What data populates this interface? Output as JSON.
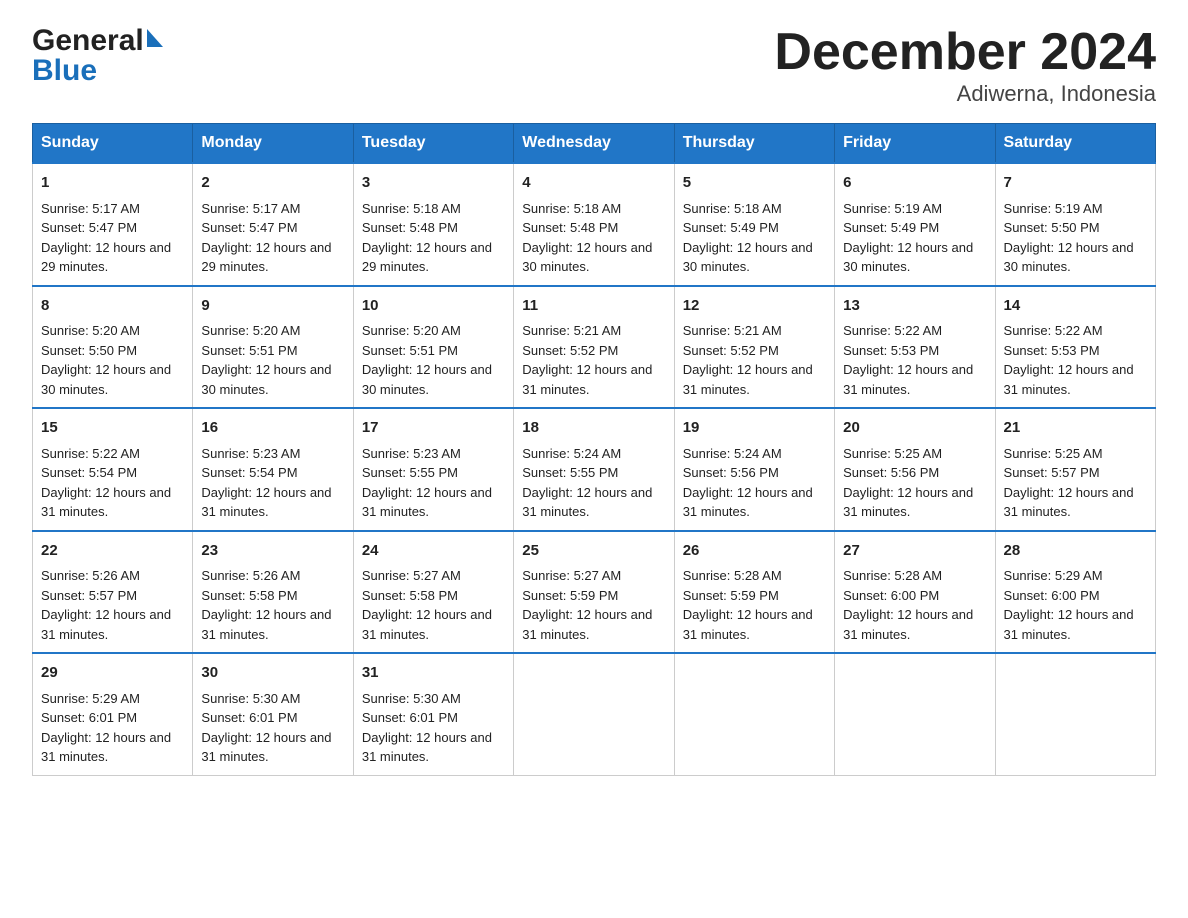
{
  "header": {
    "logo_general": "General",
    "logo_blue": "Blue",
    "title": "December 2024",
    "subtitle": "Adiwerna, Indonesia"
  },
  "weekdays": [
    "Sunday",
    "Monday",
    "Tuesday",
    "Wednesday",
    "Thursday",
    "Friday",
    "Saturday"
  ],
  "weeks": [
    [
      {
        "day": "1",
        "sunrise": "5:17 AM",
        "sunset": "5:47 PM",
        "daylight": "12 hours and 29 minutes."
      },
      {
        "day": "2",
        "sunrise": "5:17 AM",
        "sunset": "5:47 PM",
        "daylight": "12 hours and 29 minutes."
      },
      {
        "day": "3",
        "sunrise": "5:18 AM",
        "sunset": "5:48 PM",
        "daylight": "12 hours and 29 minutes."
      },
      {
        "day": "4",
        "sunrise": "5:18 AM",
        "sunset": "5:48 PM",
        "daylight": "12 hours and 30 minutes."
      },
      {
        "day": "5",
        "sunrise": "5:18 AM",
        "sunset": "5:49 PM",
        "daylight": "12 hours and 30 minutes."
      },
      {
        "day": "6",
        "sunrise": "5:19 AM",
        "sunset": "5:49 PM",
        "daylight": "12 hours and 30 minutes."
      },
      {
        "day": "7",
        "sunrise": "5:19 AM",
        "sunset": "5:50 PM",
        "daylight": "12 hours and 30 minutes."
      }
    ],
    [
      {
        "day": "8",
        "sunrise": "5:20 AM",
        "sunset": "5:50 PM",
        "daylight": "12 hours and 30 minutes."
      },
      {
        "day": "9",
        "sunrise": "5:20 AM",
        "sunset": "5:51 PM",
        "daylight": "12 hours and 30 minutes."
      },
      {
        "day": "10",
        "sunrise": "5:20 AM",
        "sunset": "5:51 PM",
        "daylight": "12 hours and 30 minutes."
      },
      {
        "day": "11",
        "sunrise": "5:21 AM",
        "sunset": "5:52 PM",
        "daylight": "12 hours and 31 minutes."
      },
      {
        "day": "12",
        "sunrise": "5:21 AM",
        "sunset": "5:52 PM",
        "daylight": "12 hours and 31 minutes."
      },
      {
        "day": "13",
        "sunrise": "5:22 AM",
        "sunset": "5:53 PM",
        "daylight": "12 hours and 31 minutes."
      },
      {
        "day": "14",
        "sunrise": "5:22 AM",
        "sunset": "5:53 PM",
        "daylight": "12 hours and 31 minutes."
      }
    ],
    [
      {
        "day": "15",
        "sunrise": "5:22 AM",
        "sunset": "5:54 PM",
        "daylight": "12 hours and 31 minutes."
      },
      {
        "day": "16",
        "sunrise": "5:23 AM",
        "sunset": "5:54 PM",
        "daylight": "12 hours and 31 minutes."
      },
      {
        "day": "17",
        "sunrise": "5:23 AM",
        "sunset": "5:55 PM",
        "daylight": "12 hours and 31 minutes."
      },
      {
        "day": "18",
        "sunrise": "5:24 AM",
        "sunset": "5:55 PM",
        "daylight": "12 hours and 31 minutes."
      },
      {
        "day": "19",
        "sunrise": "5:24 AM",
        "sunset": "5:56 PM",
        "daylight": "12 hours and 31 minutes."
      },
      {
        "day": "20",
        "sunrise": "5:25 AM",
        "sunset": "5:56 PM",
        "daylight": "12 hours and 31 minutes."
      },
      {
        "day": "21",
        "sunrise": "5:25 AM",
        "sunset": "5:57 PM",
        "daylight": "12 hours and 31 minutes."
      }
    ],
    [
      {
        "day": "22",
        "sunrise": "5:26 AM",
        "sunset": "5:57 PM",
        "daylight": "12 hours and 31 minutes."
      },
      {
        "day": "23",
        "sunrise": "5:26 AM",
        "sunset": "5:58 PM",
        "daylight": "12 hours and 31 minutes."
      },
      {
        "day": "24",
        "sunrise": "5:27 AM",
        "sunset": "5:58 PM",
        "daylight": "12 hours and 31 minutes."
      },
      {
        "day": "25",
        "sunrise": "5:27 AM",
        "sunset": "5:59 PM",
        "daylight": "12 hours and 31 minutes."
      },
      {
        "day": "26",
        "sunrise": "5:28 AM",
        "sunset": "5:59 PM",
        "daylight": "12 hours and 31 minutes."
      },
      {
        "day": "27",
        "sunrise": "5:28 AM",
        "sunset": "6:00 PM",
        "daylight": "12 hours and 31 minutes."
      },
      {
        "day": "28",
        "sunrise": "5:29 AM",
        "sunset": "6:00 PM",
        "daylight": "12 hours and 31 minutes."
      }
    ],
    [
      {
        "day": "29",
        "sunrise": "5:29 AM",
        "sunset": "6:01 PM",
        "daylight": "12 hours and 31 minutes."
      },
      {
        "day": "30",
        "sunrise": "5:30 AM",
        "sunset": "6:01 PM",
        "daylight": "12 hours and 31 minutes."
      },
      {
        "day": "31",
        "sunrise": "5:30 AM",
        "sunset": "6:01 PM",
        "daylight": "12 hours and 31 minutes."
      },
      {
        "day": "",
        "sunrise": "",
        "sunset": "",
        "daylight": ""
      },
      {
        "day": "",
        "sunrise": "",
        "sunset": "",
        "daylight": ""
      },
      {
        "day": "",
        "sunrise": "",
        "sunset": "",
        "daylight": ""
      },
      {
        "day": "",
        "sunrise": "",
        "sunset": "",
        "daylight": ""
      }
    ]
  ]
}
